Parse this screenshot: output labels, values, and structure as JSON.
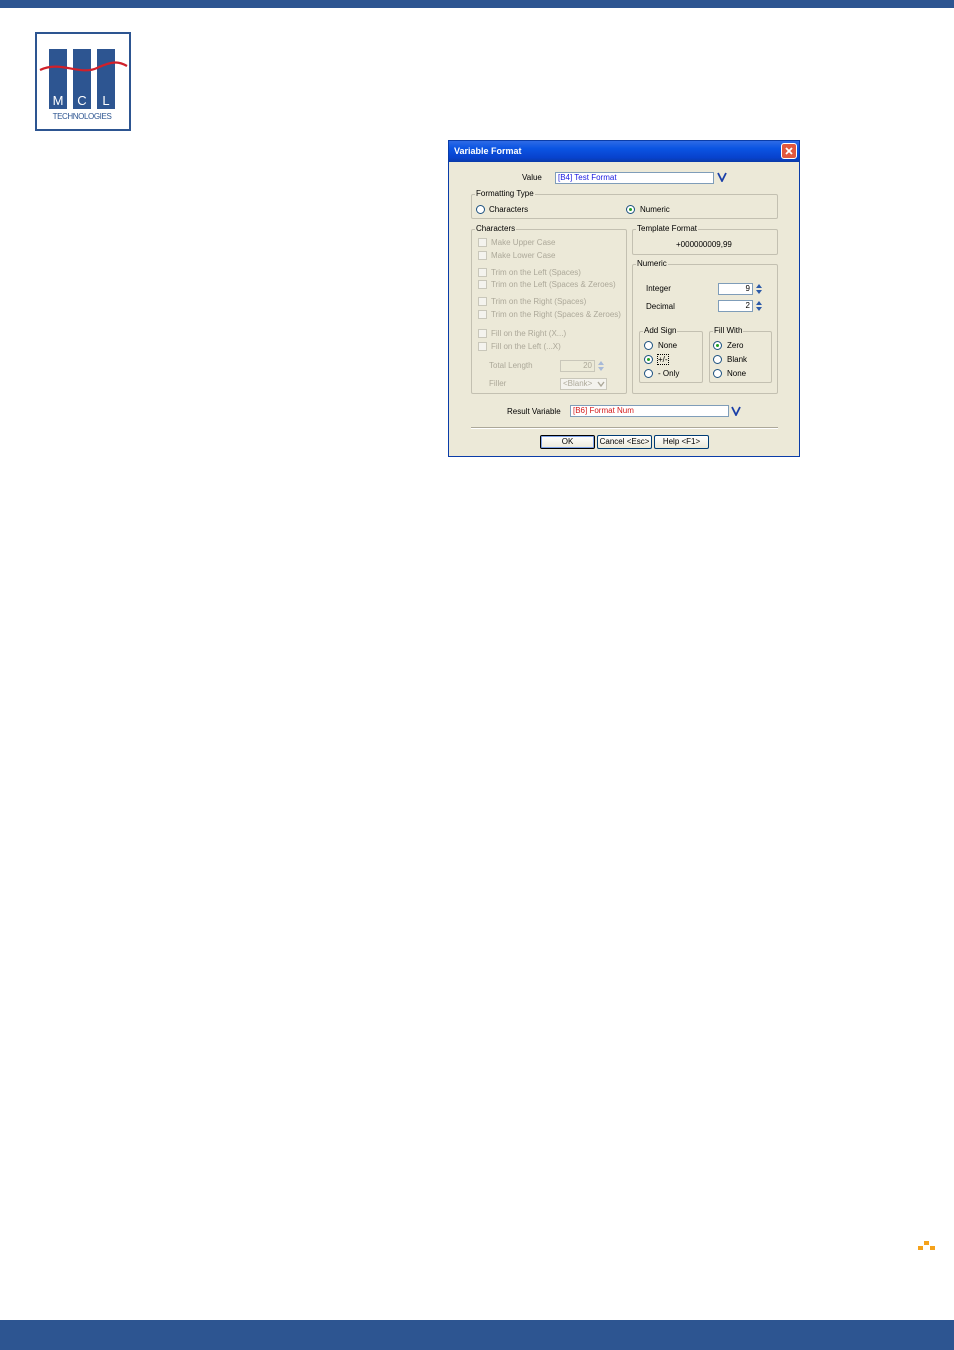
{
  "logo": {
    "letters": [
      "M",
      "C",
      "L"
    ],
    "subtitle": "TECHNOLOGIES",
    "colors": {
      "primary": "#2d5591",
      "wave": "#d0202a"
    }
  },
  "dialog": {
    "title": "Variable Format",
    "value_label": "Value",
    "value_field": "[B4] Test Format",
    "formatting_type": {
      "legend": "Formatting Type",
      "options": [
        "Characters",
        "Numeric"
      ],
      "selected": "Numeric"
    },
    "characters": {
      "legend": "Characters",
      "options": [
        "Make Upper Case",
        "Make Lower Case",
        "Trim on the Left (Spaces)",
        "Trim on the Left (Spaces & Zeroes)",
        "Trim on the Right (Spaces)",
        "Trim on the Right (Spaces & Zeroes)",
        "Fill on the Right (X...)",
        "Fill on the Left (...X)"
      ],
      "total_length_label": "Total Length",
      "total_length_value": "20",
      "filler_label": "Filler",
      "filler_value": "<Blank>"
    },
    "template_format": {
      "legend": "Template Format",
      "value": "+000000009,99"
    },
    "numeric": {
      "legend": "Numeric",
      "integer_label": "Integer",
      "integer_value": "9",
      "decimal_label": "Decimal",
      "decimal_value": "2",
      "add_sign": {
        "legend": "Add Sign",
        "options": [
          "None",
          "+/-",
          "- Only"
        ],
        "selected": "+/-"
      },
      "fill_with": {
        "legend": "Fill With",
        "options": [
          "Zero",
          "Blank",
          "None"
        ],
        "selected": "Zero"
      }
    },
    "result_variable_label": "Result Variable",
    "result_variable_field": "[B6] Format Num",
    "buttons": {
      "ok": "OK",
      "cancel": "Cancel <Esc>",
      "help": "Help <F1>"
    }
  },
  "colors": {
    "header_bar": "#2d5591",
    "title_bar": "#0b54e3",
    "dialog_bg": "#ece9d8",
    "accent": "#f5a21b"
  }
}
